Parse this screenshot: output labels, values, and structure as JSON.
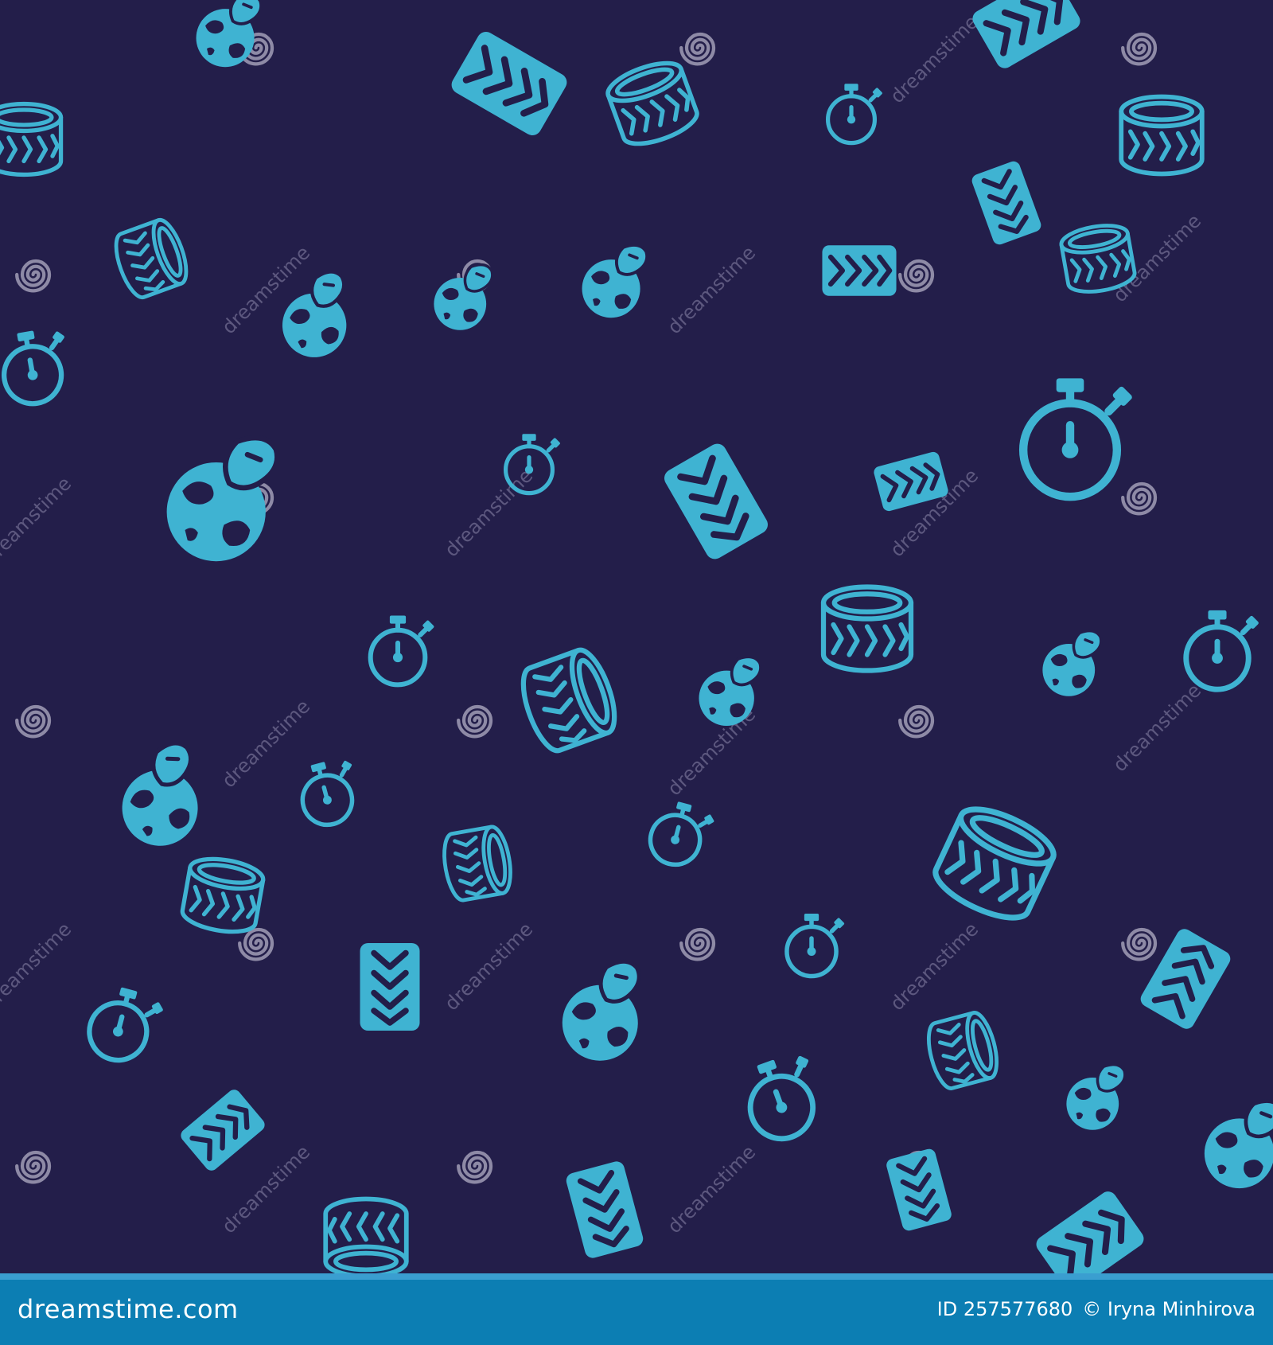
{
  "colors": {
    "background": "#231e4a",
    "icon": "#3fb3d2",
    "watermark_swirl": "#8e8aa6",
    "watermark_text": "#5d587f",
    "footer": "#0c7eb3",
    "footer_accent": "#3a9ed0"
  },
  "icons": {
    "tire": "tire-icon",
    "tire_tread": "tire-tread-icon",
    "stopwatch": "stopwatch-icon",
    "globe": "globe-with-flag-icon",
    "watermark": "dreamstime-swirl-icon"
  },
  "watermark": {
    "text": "dreamstime"
  },
  "footer": {
    "logo": "dreamstime.com",
    "id": "ID 257577680",
    "credit": "© Iryna Minhirova"
  }
}
